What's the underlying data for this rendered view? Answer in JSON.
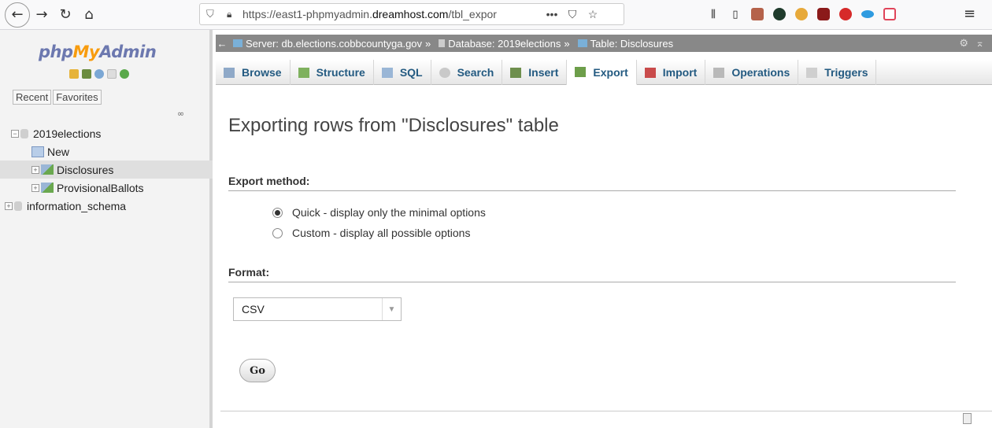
{
  "browser": {
    "url_prefix": "https://east1-phpmyadmin.",
    "url_domain": "dreamhost.com",
    "url_suffix": "/tbl_expor",
    "more_label": "•••"
  },
  "sidebar": {
    "logo_php": "php",
    "logo_my": "My",
    "logo_admin": "Admin",
    "tabs": [
      "Recent",
      "Favorites"
    ],
    "tree": [
      {
        "label": "2019elections",
        "expander": "−"
      },
      {
        "label": "New"
      },
      {
        "label": "Disclosures",
        "expander": "+"
      },
      {
        "label": "ProvisionalBallots",
        "expander": "+"
      },
      {
        "label": "information_schema",
        "expander": "+"
      }
    ]
  },
  "serverbar": {
    "server": "Server: db.elections.cobbcountyga.gov",
    "database": "Database: 2019elections",
    "table": "Table: Disclosures",
    "sep": "»"
  },
  "tabs": [
    {
      "label": "Browse",
      "color": "#8fa9c8"
    },
    {
      "label": "Structure",
      "color": "#7fb15e"
    },
    {
      "label": "SQL",
      "color": "#9ab6d6"
    },
    {
      "label": "Search",
      "color": "#c9c9c9"
    },
    {
      "label": "Insert",
      "color": "#6e8f4d"
    },
    {
      "label": "Export",
      "color": "#6d9e4a",
      "active": true
    },
    {
      "label": "Import",
      "color": "#c94b4b"
    },
    {
      "label": "Operations",
      "color": "#b9b9b9"
    },
    {
      "label": "Triggers",
      "color": "#cfcfcf"
    }
  ],
  "main": {
    "title": "Exporting rows from \"Disclosures\" table",
    "export_method_title": "Export method:",
    "method_quick": "Quick - display only the minimal options",
    "method_custom": "Custom - display all possible options",
    "format_title": "Format:",
    "format_value": "CSV",
    "go_label": "Go"
  },
  "colors": {
    "accent": "#235a81",
    "logo_blue": "#6c78af",
    "logo_orange": "#f89c0e"
  }
}
